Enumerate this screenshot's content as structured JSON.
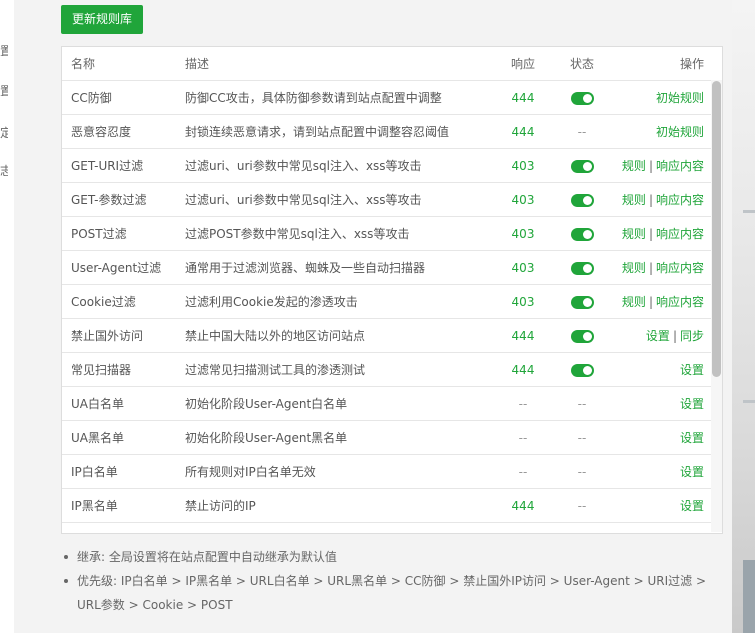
{
  "toolbar": {
    "update_label": "更新规则库"
  },
  "left_sidebar": {
    "fragments": [
      "置",
      "置",
      "定",
      "志"
    ]
  },
  "table": {
    "headers": {
      "name": "名称",
      "desc": "描述",
      "resp": "响应",
      "status": "状态",
      "ops": "操作"
    },
    "rows": [
      {
        "name": "CC防御",
        "desc": "防御CC攻击，具体防御参数请到站点配置中调整",
        "resp": "444",
        "status": "on",
        "status_text": "",
        "ops": [
          "初始规则"
        ]
      },
      {
        "name": "恶意容忍度",
        "desc": "封锁连续恶意请求，请到站点配置中调整容忍阈值",
        "resp": "444",
        "status": "off",
        "status_text": "--",
        "ops": [
          "初始规则"
        ]
      },
      {
        "name": "GET-URI过滤",
        "desc": "过滤uri、uri参数中常见sql注入、xss等攻击",
        "resp": "403",
        "status": "on",
        "status_text": "",
        "ops": [
          "规则",
          "响应内容"
        ]
      },
      {
        "name": "GET-参数过滤",
        "desc": "过滤uri、uri参数中常见sql注入、xss等攻击",
        "resp": "403",
        "status": "on",
        "status_text": "",
        "ops": [
          "规则",
          "响应内容"
        ]
      },
      {
        "name": "POST过滤",
        "desc": "过滤POST参数中常见sql注入、xss等攻击",
        "resp": "403",
        "status": "on",
        "status_text": "",
        "ops": [
          "规则",
          "响应内容"
        ]
      },
      {
        "name": "User-Agent过滤",
        "desc": "通常用于过滤浏览器、蜘蛛及一些自动扫描器",
        "resp": "403",
        "status": "on",
        "status_text": "",
        "ops": [
          "规则",
          "响应内容"
        ]
      },
      {
        "name": "Cookie过滤",
        "desc": "过滤利用Cookie发起的渗透攻击",
        "resp": "403",
        "status": "on",
        "status_text": "",
        "ops": [
          "规则",
          "响应内容"
        ]
      },
      {
        "name": "禁止国外访问",
        "desc": "禁止中国大陆以外的地区访问站点",
        "resp": "444",
        "status": "on",
        "status_text": "",
        "ops": [
          "设置",
          "同步"
        ]
      },
      {
        "name": "常见扫描器",
        "desc": "过滤常见扫描测试工具的渗透测试",
        "resp": "444",
        "status": "on",
        "status_text": "",
        "ops": [
          "设置"
        ]
      },
      {
        "name": "UA白名单",
        "desc": "初始化阶段User-Agent白名单",
        "resp": "--",
        "status": "off",
        "status_text": "--",
        "ops": [
          "设置"
        ]
      },
      {
        "name": "UA黑名单",
        "desc": "初始化阶段User-Agent黑名单",
        "resp": "--",
        "status": "off",
        "status_text": "--",
        "ops": [
          "设置"
        ]
      },
      {
        "name": "IP白名单",
        "desc": "所有规则对IP白名单无效",
        "resp": "--",
        "status": "off",
        "status_text": "--",
        "ops": [
          "设置"
        ]
      },
      {
        "name": "IP黑名单",
        "desc": "禁止访问的IP",
        "resp": "444",
        "status": "off",
        "status_text": "--",
        "ops": [
          "设置"
        ]
      }
    ]
  },
  "notes": [
    "继承: 全局设置将在站点配置中自动继承为默认值",
    "优先级: IP白名单 > IP黑名单 > URL白名单 > URL黑名单 > CC防御 > 禁止国外IP访问 > User-Agent > URI过滤 > URL参数 > Cookie > POST"
  ],
  "colors": {
    "accent": "#20a53a",
    "text": "#555555",
    "muted": "#999999",
    "border": "#dddddd"
  }
}
